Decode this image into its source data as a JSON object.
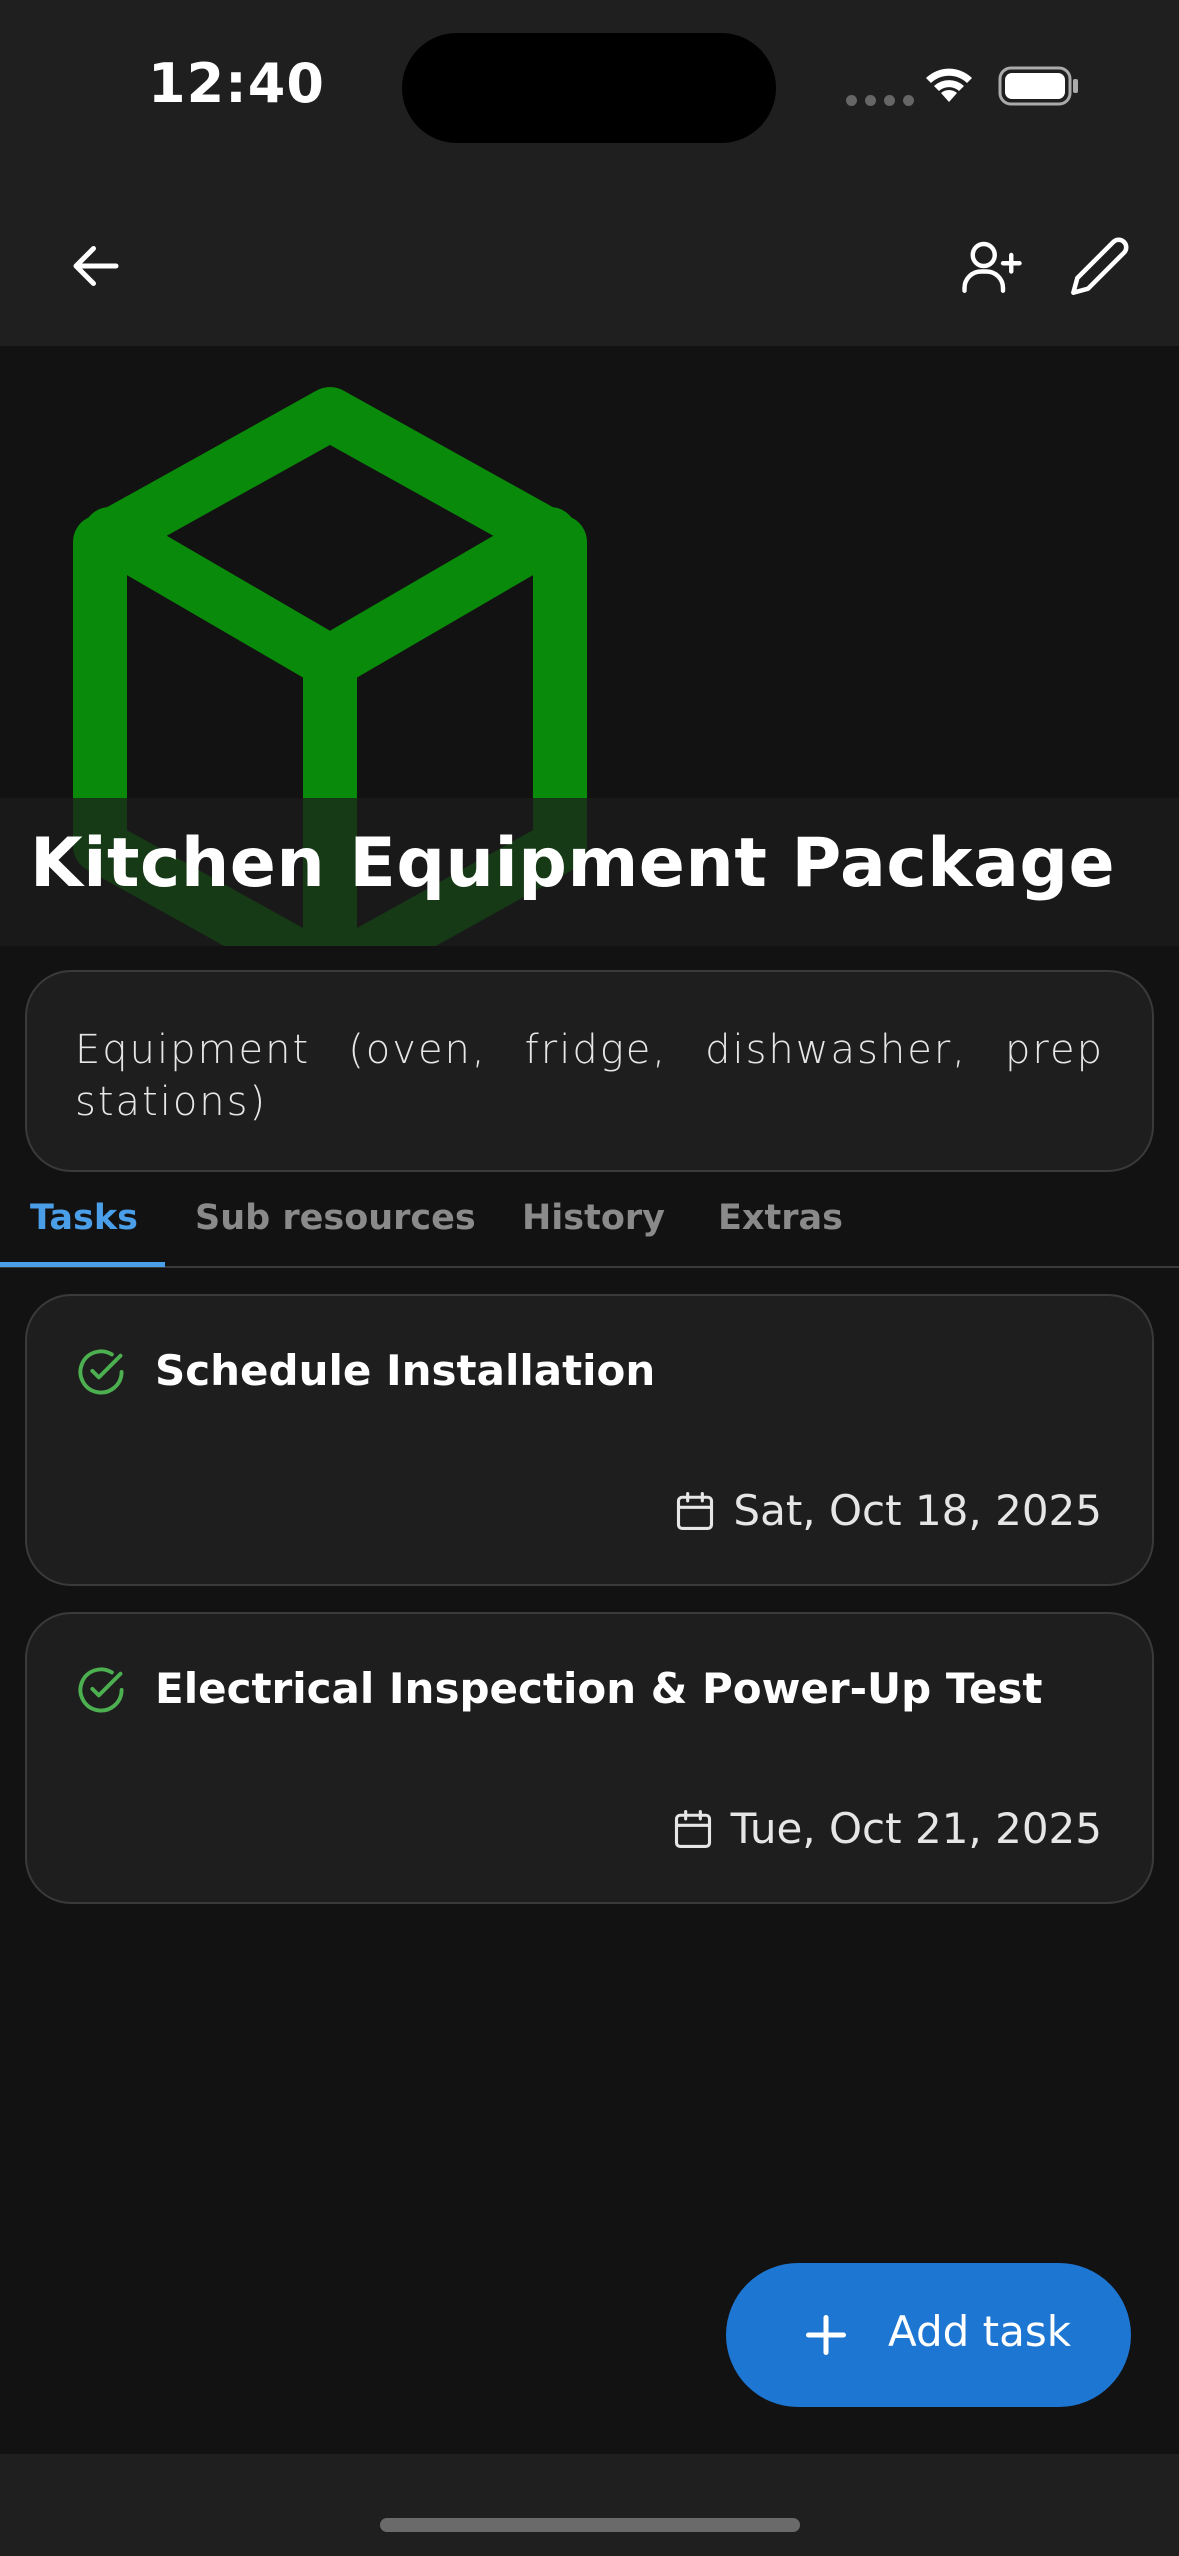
{
  "status_bar": {
    "time": "12:40"
  },
  "app_bar": {
    "back_icon": "arrow-left-icon",
    "add_user_icon": "user-plus-icon",
    "edit_icon": "pencil-icon"
  },
  "hero": {
    "icon": "cube-icon",
    "icon_color": "#0a8a0a",
    "title": "Kitchen Equipment Package"
  },
  "description": "Equipment (oven, fridge, dishwasher, prep stations)",
  "tabs": [
    {
      "label": "Tasks",
      "active": true
    },
    {
      "label": "Sub resources",
      "active": false
    },
    {
      "label": "History",
      "active": false
    },
    {
      "label": "Extras",
      "active": false
    }
  ],
  "tasks": [
    {
      "title": "Schedule Installation",
      "date": "Sat, Oct 18, 2025",
      "status_icon": "check-circle-icon",
      "date_icon": "calendar-icon"
    },
    {
      "title": "Electrical Inspection & Power-Up Test",
      "date": "Tue, Oct 21, 2025",
      "status_icon": "check-circle-icon",
      "date_icon": "calendar-icon"
    }
  ],
  "fab": {
    "label": "Add task",
    "icon": "plus-icon"
  },
  "colors": {
    "accent": "#4a9fe8",
    "fab": "#1d76d2",
    "success": "#4caf50",
    "background": "#121212",
    "surface": "#1e1e1e"
  }
}
